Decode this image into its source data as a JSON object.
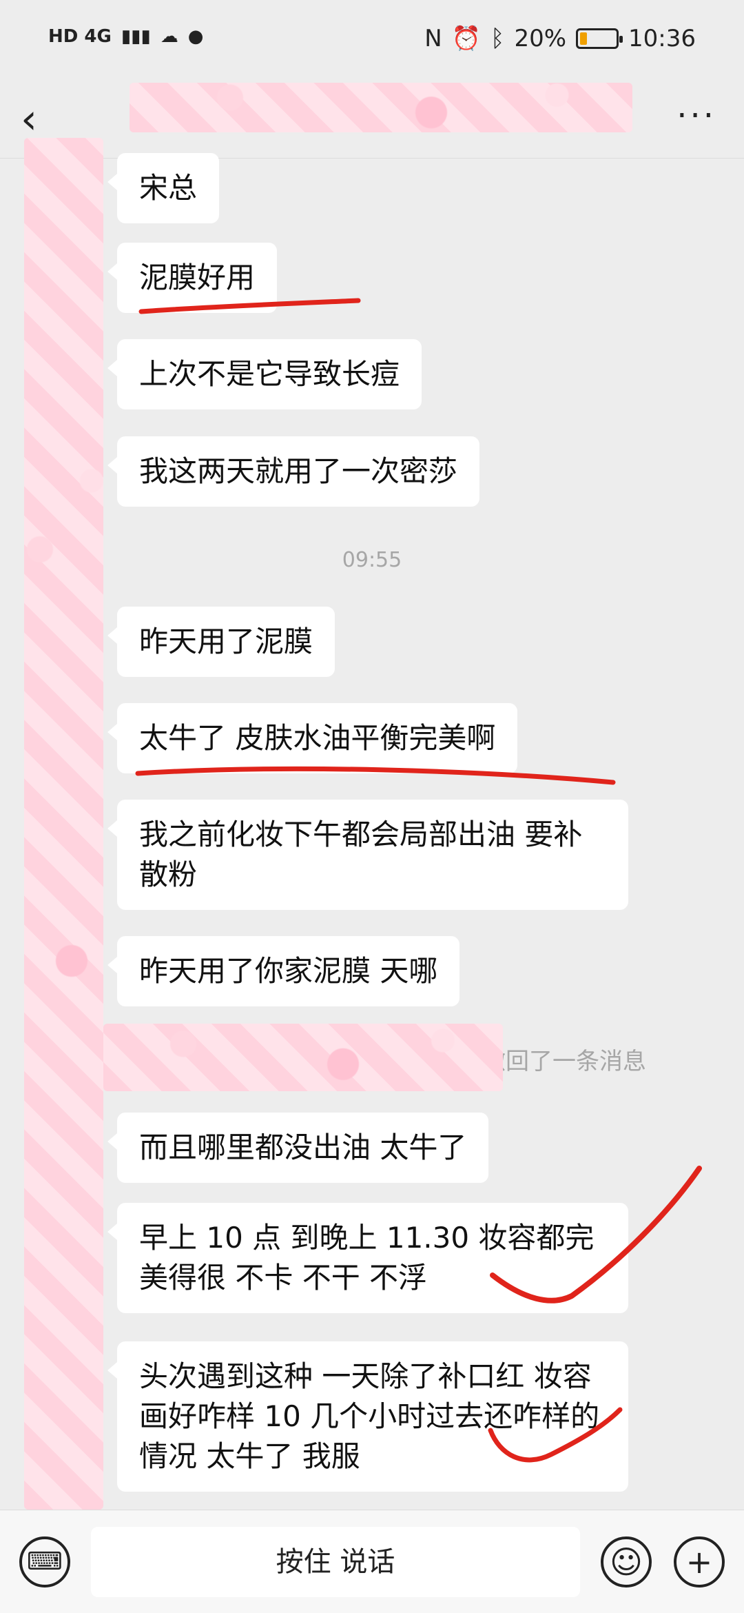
{
  "status": {
    "left_text": "HD 4G",
    "battery": "20%",
    "battery_level": 0.2,
    "time": "10:36"
  },
  "nav": {
    "back_icon": "‹",
    "more_icon": "···"
  },
  "messages": [
    {
      "text": "宋总"
    },
    {
      "text": "泥膜好用"
    },
    {
      "text": "上次不是它导致长痘"
    },
    {
      "text": "我这两天就用了一次密莎"
    },
    {
      "text": "昨天用了泥膜"
    },
    {
      "text": "太牛了 皮肤水油平衡完美啊"
    },
    {
      "text": "我之前化妆下午都会局部出油 要补散粉"
    },
    {
      "text": "昨天用了你家泥膜 天哪"
    },
    {
      "text": "而且哪里都没出油 太牛了"
    },
    {
      "text": "早上 10 点 到晚上 11.30 妆容都完美得很 不卡 不干 不浮"
    },
    {
      "text": "头次遇到这种 一天除了补口红 妆容画好咋样 10 几个小时过去还咋样的情况 太牛了 我服"
    }
  ],
  "timestamp": "09:55",
  "recall_text": "撤回了一条消息",
  "input": {
    "talk_label": "按住 说话",
    "keyboard_icon": "⌨",
    "emoji_icon": "☺",
    "plus_icon": "+"
  },
  "colors": {
    "annotation": "#e0241b",
    "background": "#ededed"
  }
}
